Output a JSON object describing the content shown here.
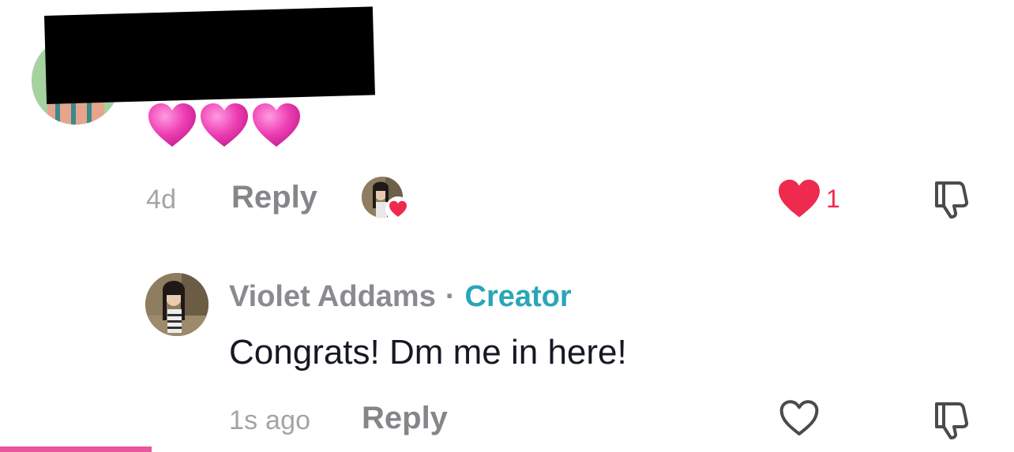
{
  "top_comment": {
    "body_emoji": "💗💗💗",
    "time": "4d",
    "reply_label": "Reply",
    "like_count": "1",
    "liked": true,
    "creator_liked": true
  },
  "reply_comment": {
    "author": "Violet Addams",
    "separator": "·",
    "badge": "Creator",
    "text": "Congrats! Dm me in here!",
    "time": "1s ago",
    "reply_label": "Reply",
    "liked": false
  },
  "colors": {
    "like_red": "#ee2a4f",
    "creator_teal": "#2aa6b8",
    "heart_pink": "#ee3fb4",
    "bottom_bar_pink": "#e8569d"
  },
  "icons": {
    "like_filled": "heart-filled-icon",
    "like_outline": "heart-outline-icon",
    "dislike": "thumbs-down-icon",
    "emoji": "pink-heart-emoji"
  }
}
